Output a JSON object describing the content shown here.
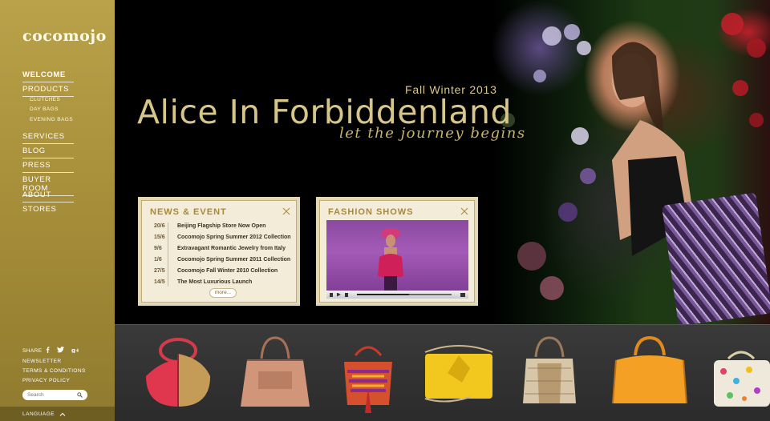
{
  "brand": {
    "logo_text": "cocomojo"
  },
  "nav": {
    "main": [
      {
        "label": "WELCOME",
        "active": true
      },
      {
        "label": "PRODUCTS",
        "active": false
      },
      {
        "label": "SERVICES",
        "active": false
      },
      {
        "label": "BLOG",
        "active": false
      },
      {
        "label": "PRESS",
        "active": false
      },
      {
        "label": "BUYER ROOM",
        "active": false
      },
      {
        "label": "ABOUT",
        "active": false
      },
      {
        "label": "STORES",
        "active": false
      }
    ],
    "products_sub": [
      "CLUTCHES",
      "DAY BAGS",
      "EVENING BAGS"
    ]
  },
  "footer": {
    "share_label": "SHARE",
    "social_icons": [
      "facebook-icon",
      "twitter-icon",
      "google-plus-icon"
    ],
    "links": [
      "NEWSLETTER",
      "TERMS & CONDITIONS",
      "PRIVACY POLICY"
    ],
    "search_placeholder": "Search",
    "language_label": "LANGUAGE"
  },
  "hero": {
    "season": "Fall Winter 2013",
    "title": "Alice In Forbiddenland",
    "tagline": "let the journey begins"
  },
  "news": {
    "title": "NEWS & EVENT",
    "items": [
      {
        "date": "20/6",
        "text": "Beijing Flagship Store Now Open"
      },
      {
        "date": "15/6",
        "text": "Cocomojo Spring Summer 2012 Collection"
      },
      {
        "date": "9/6",
        "text": "Extravagant Romantic Jewelry from Italy"
      },
      {
        "date": "1/6",
        "text": "Cocomojo Spring Summer 2011 Collection"
      },
      {
        "date": "27/5",
        "text": "Cocomojo Fall Winter 2010 Collection"
      },
      {
        "date": "14/5",
        "text": "The Most Luxurious Launch"
      }
    ],
    "more_label": "more..."
  },
  "fashion_shows": {
    "title": "FASHION SHOWS",
    "video_progress": 0.55
  },
  "colors": {
    "gold": "#b9a24a",
    "hero_text": "#d7c68a",
    "panel_bg": "#f3ecd8",
    "panel_title": "#a8893a",
    "strip_bg": "#2f2f2f"
  },
  "products_strip": [
    {
      "icon": "bag-red-gold-hobo"
    },
    {
      "icon": "bag-tan-python-tote"
    },
    {
      "icon": "bag-multicolor-bucket"
    },
    {
      "icon": "bag-yellow-clutch"
    },
    {
      "icon": "bag-snakeskin-tote"
    },
    {
      "icon": "bag-orange-satchel"
    },
    {
      "icon": "bag-embellished-white"
    }
  ]
}
